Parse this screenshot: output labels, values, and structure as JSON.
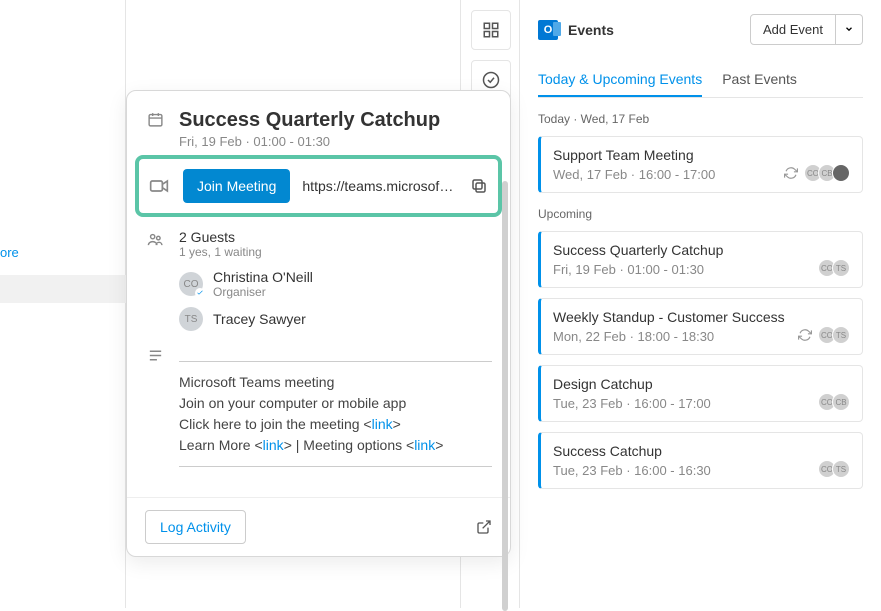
{
  "left": {
    "more_label": "ore"
  },
  "gutter": {
    "grid_icon": "grid-icon",
    "check_icon": "check-circle-icon"
  },
  "popover": {
    "title": "Success Quarterly Catchup",
    "date_line": "Fri, 19 Feb · 01:00 - 01:30",
    "join_label": "Join Meeting",
    "meeting_url": "https://teams.microsof…",
    "guests_header": "2 Guests",
    "guests_sub": "1 yes, 1 waiting",
    "attendees": [
      {
        "initials": "CO",
        "name": "Christina O'Neill",
        "role": "Organiser",
        "confirmed": true
      },
      {
        "initials": "TS",
        "name": "Tracey Sawyer",
        "role": "",
        "confirmed": false
      }
    ],
    "desc": {
      "l1": "Microsoft Teams meeting",
      "l2": "Join on your computer or mobile app",
      "l3a": "Click here to join the meeting <",
      "l3b": "link",
      "l3c": ">",
      "l4a": "Learn More <",
      "l4b": "link",
      "l4c": "> | Meeting options <",
      "l4d": "link",
      "l4e": ">"
    },
    "log_label": "Log Activity"
  },
  "panel": {
    "title": "Events",
    "add_label": "Add Event",
    "tabs": {
      "upcoming": "Today & Upcoming Events",
      "past": "Past Events"
    },
    "today_label": "Today · Wed, 17 Feb",
    "upcoming_label": "Upcoming",
    "events": [
      {
        "title": "Support Team Meeting",
        "time": "Wed, 17 Feb · 16:00 - 17:00",
        "refresh": true,
        "avatars": 3
      },
      {
        "title": "Success Quarterly Catchup",
        "time": "Fri, 19 Feb · 01:00 - 01:30",
        "refresh": false,
        "avatars": 2
      },
      {
        "title": "Weekly Standup - Customer Success",
        "time": "Mon, 22 Feb · 18:00 - 18:30",
        "refresh": true,
        "avatars": 2
      },
      {
        "title": "Design Catchup",
        "time": "Tue, 23 Feb · 16:00 - 17:00",
        "refresh": false,
        "avatars": 2
      },
      {
        "title": "Success Catchup",
        "time": "Tue, 23 Feb · 16:00 - 16:30",
        "refresh": false,
        "avatars": 2
      }
    ]
  }
}
